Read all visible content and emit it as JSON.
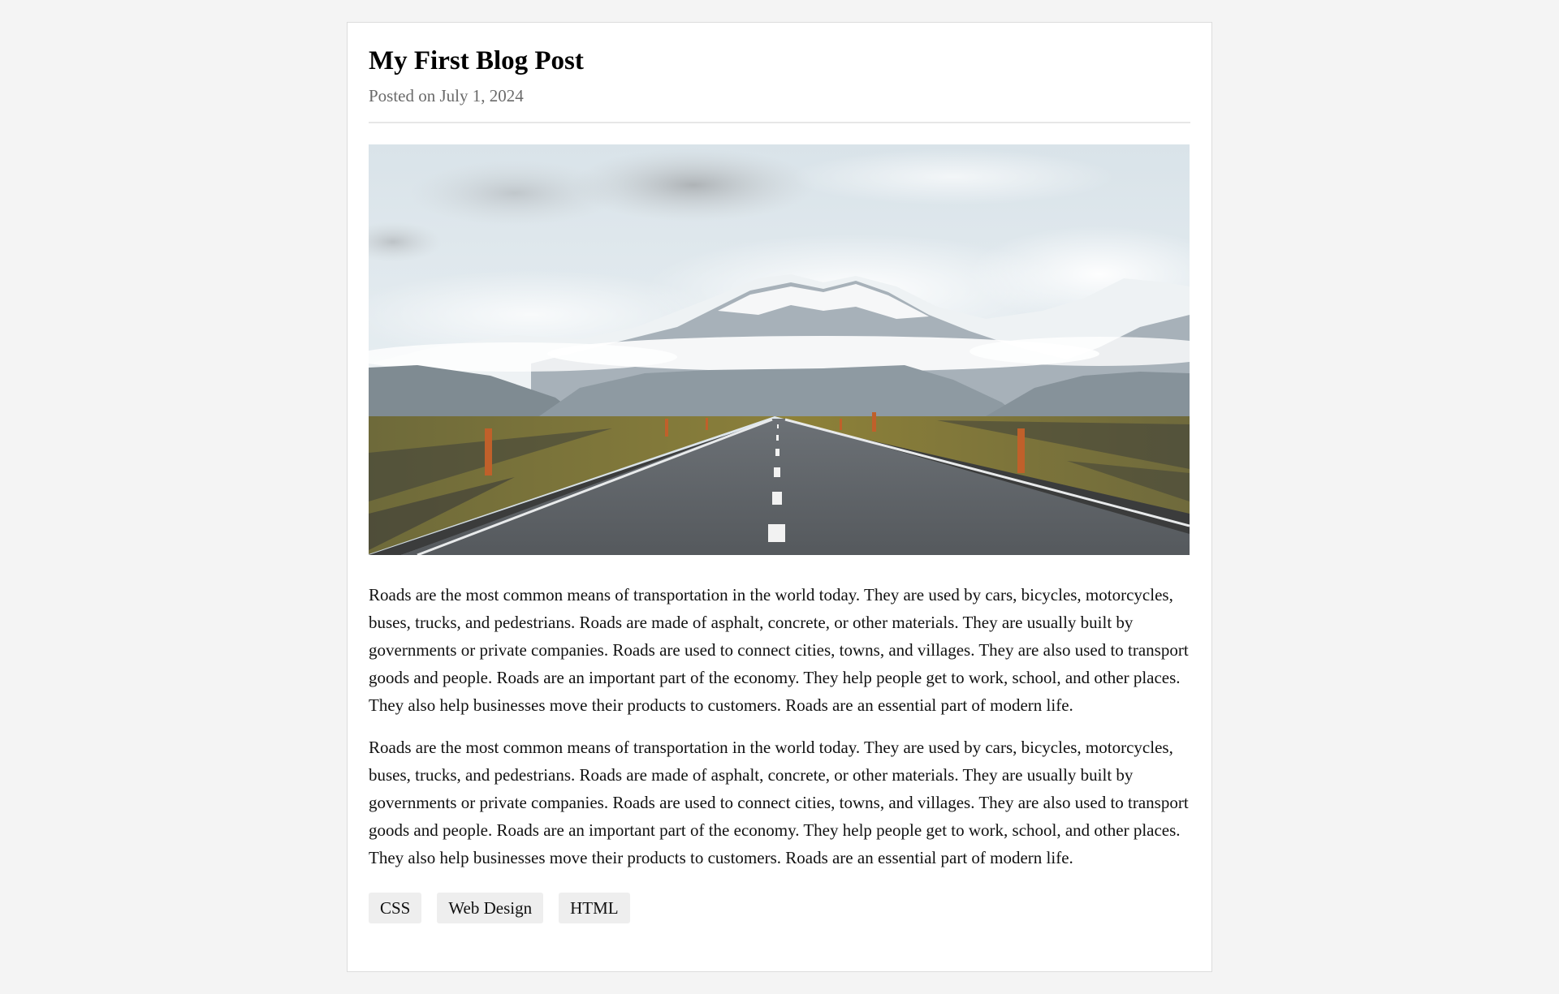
{
  "post": {
    "title": "My First Blog Post",
    "meta": "Posted on July 1, 2024",
    "paragraphs": [
      "Roads are the most common means of transportation in the world today. They are used by cars, bicycles, motorcycles, buses, trucks, and pedestrians. Roads are made of asphalt, concrete, or other materials. They are usually built by governments or private companies. Roads are used to connect cities, towns, and villages. They are also used to transport goods and people. Roads are an important part of the economy. They help people get to work, school, and other places. They also help businesses move their products to customers. Roads are an essential part of modern life.",
      "Roads are the most common means of transportation in the world today. They are used by cars, bicycles, motorcycles, buses, trucks, and pedestrians. Roads are made of asphalt, concrete, or other materials. They are usually built by governments or private companies. Roads are used to connect cities, towns, and villages. They are also used to transport goods and people. Roads are an important part of the economy. They help people get to work, school, and other places. They also help businesses move their products to customers. Roads are an essential part of modern life."
    ],
    "tags": [
      "CSS",
      "Web Design",
      "HTML"
    ]
  },
  "colors": {
    "page_background": "#f4f4f4",
    "card_background": "#ffffff",
    "meta_text": "#6a6a6a",
    "tag_background": "#eeeeee"
  }
}
